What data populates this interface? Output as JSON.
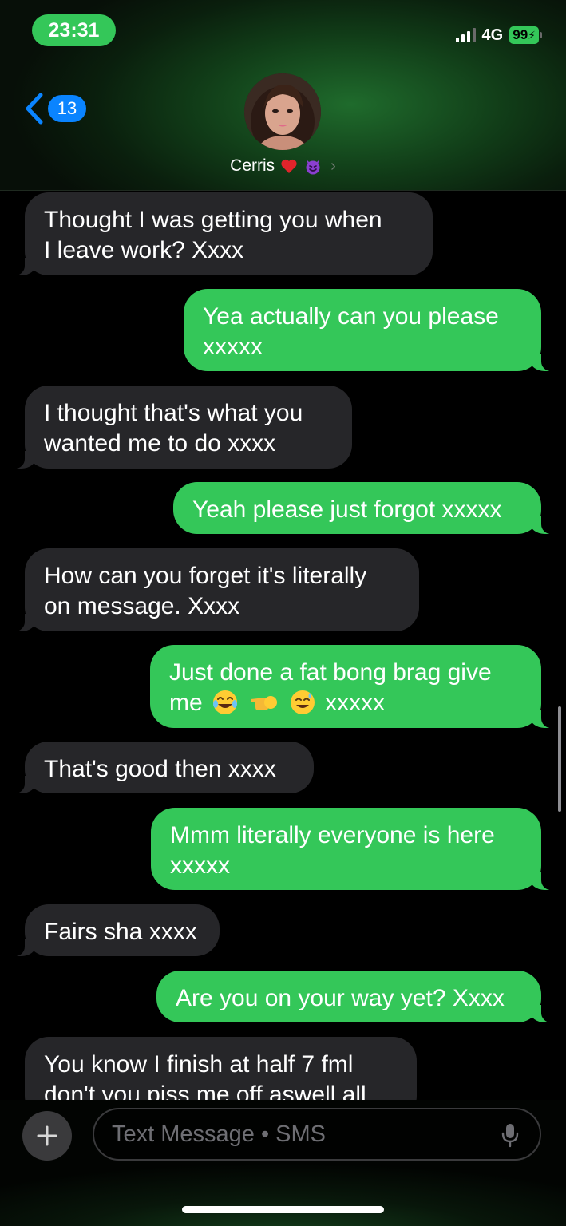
{
  "status_bar": {
    "time": "23:31",
    "network": "4G",
    "battery": "99"
  },
  "nav": {
    "back_count": "13",
    "contact_name": "Cerris",
    "contact_emojis": [
      "red-heart",
      "smiling-face-with-horns"
    ]
  },
  "messages": [
    {
      "direction": "in",
      "lines": [
        "Thought I was getting you when",
        "I leave work? Xxxx"
      ]
    },
    {
      "direction": "out",
      "lines": [
        "Yea actually can you please",
        "xxxxx"
      ]
    },
    {
      "direction": "in",
      "lines": [
        "I thought that's what you",
        "wanted me to do xxxx"
      ]
    },
    {
      "direction": "out",
      "lines": [
        "Yeah please just forgot xxxxx"
      ]
    },
    {
      "direction": "in",
      "lines": [
        "How can you forget it's literally",
        "on message. Xxxx"
      ]
    },
    {
      "direction": "out",
      "lines": [
        "Just done a fat bong brag give",
        "me",
        "xxxxx"
      ]
    },
    {
      "direction": "in",
      "lines": [
        "That's good then xxxx"
      ]
    },
    {
      "direction": "out",
      "lines": [
        "Mmm literally everyone is here",
        "xxxxx"
      ]
    },
    {
      "direction": "in",
      "lines": [
        "Fairs sha xxxx"
      ]
    },
    {
      "direction": "out",
      "lines": [
        "Are you on your way yet? Xxxx"
      ]
    },
    {
      "direction": "in",
      "lines": [
        "You know I finish at half 7 fml",
        "don't you piss me off aswell all"
      ]
    }
  ],
  "composer": {
    "placeholder": "Text Message • SMS"
  },
  "colors": {
    "sent_bubble": "#34c759",
    "received_bubble": "#262629",
    "accent": "#0a84ff"
  }
}
